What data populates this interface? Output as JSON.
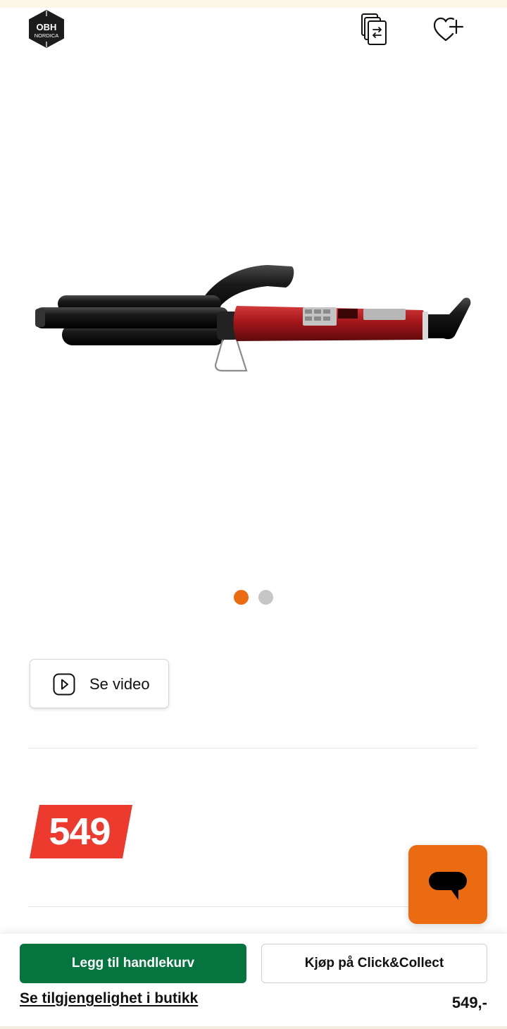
{
  "header": {
    "brand_logo": {
      "line1": "OBH",
      "line2": "NORDICA",
      "icon": "obh-nordica-logo"
    },
    "compare_icon": "compare-icon",
    "wishlist_icon": "heart-plus-icon"
  },
  "product": {
    "image_icon": "hair-waver-image",
    "carousel": {
      "total": 2,
      "active_index": 1
    }
  },
  "video": {
    "label": "Se video",
    "icon": "play-icon"
  },
  "price": {
    "amount": "549",
    "badge_color": "#ec3b2e"
  },
  "chat": {
    "icon": "chat-bubble-icon",
    "color": "#ea6b10"
  },
  "bottom_bar": {
    "add_to_cart_label": "Legg til handlekurv",
    "click_collect_label": "Kjøp på Click&Collect",
    "store_availability_label": "Se tilgjengelighet i butikk",
    "price": "549,-",
    "primary_color": "#06743e"
  }
}
